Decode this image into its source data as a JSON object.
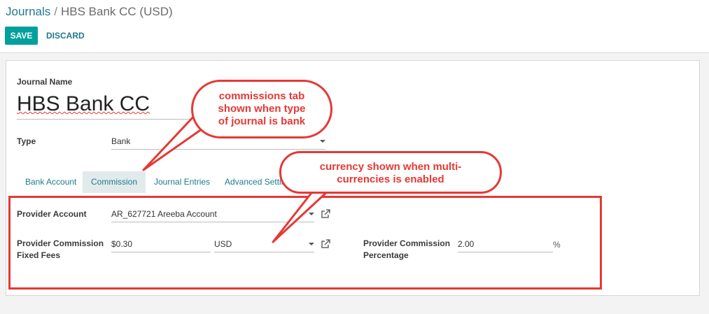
{
  "breadcrumb": {
    "parent": "Journals",
    "separator": "/",
    "current": "HBS Bank CC (USD)"
  },
  "actions": {
    "save_label": "SAVE",
    "discard_label": "DISCARD"
  },
  "form": {
    "journal_name_label": "Journal Name",
    "journal_name_value": "HBS Bank CC",
    "type_label": "Type",
    "type_value": "Bank",
    "tabs": [
      {
        "label": "Bank Account",
        "active": false
      },
      {
        "label": "Commission",
        "active": true
      },
      {
        "label": "Journal Entries",
        "active": false
      },
      {
        "label": "Advanced Settings",
        "active": false
      }
    ],
    "provider_account_label": "Provider Account",
    "provider_account_value": "AR_627721 Areeba Account",
    "fixed_fees_label_line1": "Provider Commission",
    "fixed_fees_label_line2": "Fixed Fees",
    "fixed_fees_value": "$0.30",
    "currency_value": "USD",
    "percentage_label_line1": "Provider Commission",
    "percentage_label_line2": "Percentage",
    "percentage_value": "2.00",
    "percentage_unit": "%"
  },
  "annotations": {
    "commissions_tab": [
      "commissions tab",
      "shown when type",
      "of journal is bank"
    ],
    "currency": [
      "currency shown when multi-",
      "currencies is enabled"
    ],
    "color": "#e53935"
  },
  "colors": {
    "accent": "#00a09d",
    "link": "#1f7a8c",
    "annotation": "#e53935"
  },
  "icons": {
    "external_link": "external-link-icon",
    "dropdown": "chevron-down-icon"
  }
}
